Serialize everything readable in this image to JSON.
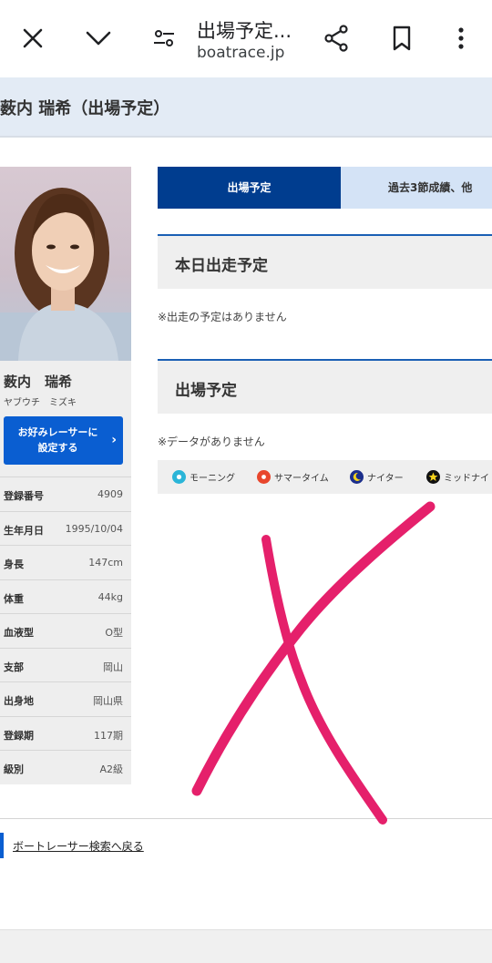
{
  "browser": {
    "title": "出場予定...",
    "url": "boatrace.jp"
  },
  "page": {
    "title": "薮内 瑞希（出場予定）"
  },
  "racer": {
    "name": "薮内　瑞希",
    "kana": "ヤブウチ　ミズキ",
    "favorite_button": [
      "お好みレーサーに",
      "設定する"
    ],
    "info": [
      {
        "label": "登録番号",
        "value": "4909"
      },
      {
        "label": "生年月日",
        "value": "1995/10/04"
      },
      {
        "label": "身長",
        "value": "147cm"
      },
      {
        "label": "体重",
        "value": "44kg"
      },
      {
        "label": "血液型",
        "value": "O型"
      },
      {
        "label": "支部",
        "value": "岡山"
      },
      {
        "label": "出身地",
        "value": "岡山県"
      },
      {
        "label": "登録期",
        "value": "117期"
      },
      {
        "label": "級別",
        "value": "A2級"
      }
    ]
  },
  "tabs": {
    "active": "出場予定",
    "other": "過去3節成績、他"
  },
  "today": {
    "heading": "本日出走予定",
    "note": "※出走の予定はありません"
  },
  "schedule": {
    "heading": "出場予定",
    "note": "※データがありません"
  },
  "legend": {
    "morning": "モーニング",
    "summer": "サマータイム",
    "nighter": "ナイター",
    "midnight": "ミッドナイト"
  },
  "footer": {
    "back_link": "ボートレーサー検索へ戻る"
  },
  "colors": {
    "accent": "#003d8f",
    "button": "#0a5ed1",
    "scribble": "#e5206b"
  }
}
